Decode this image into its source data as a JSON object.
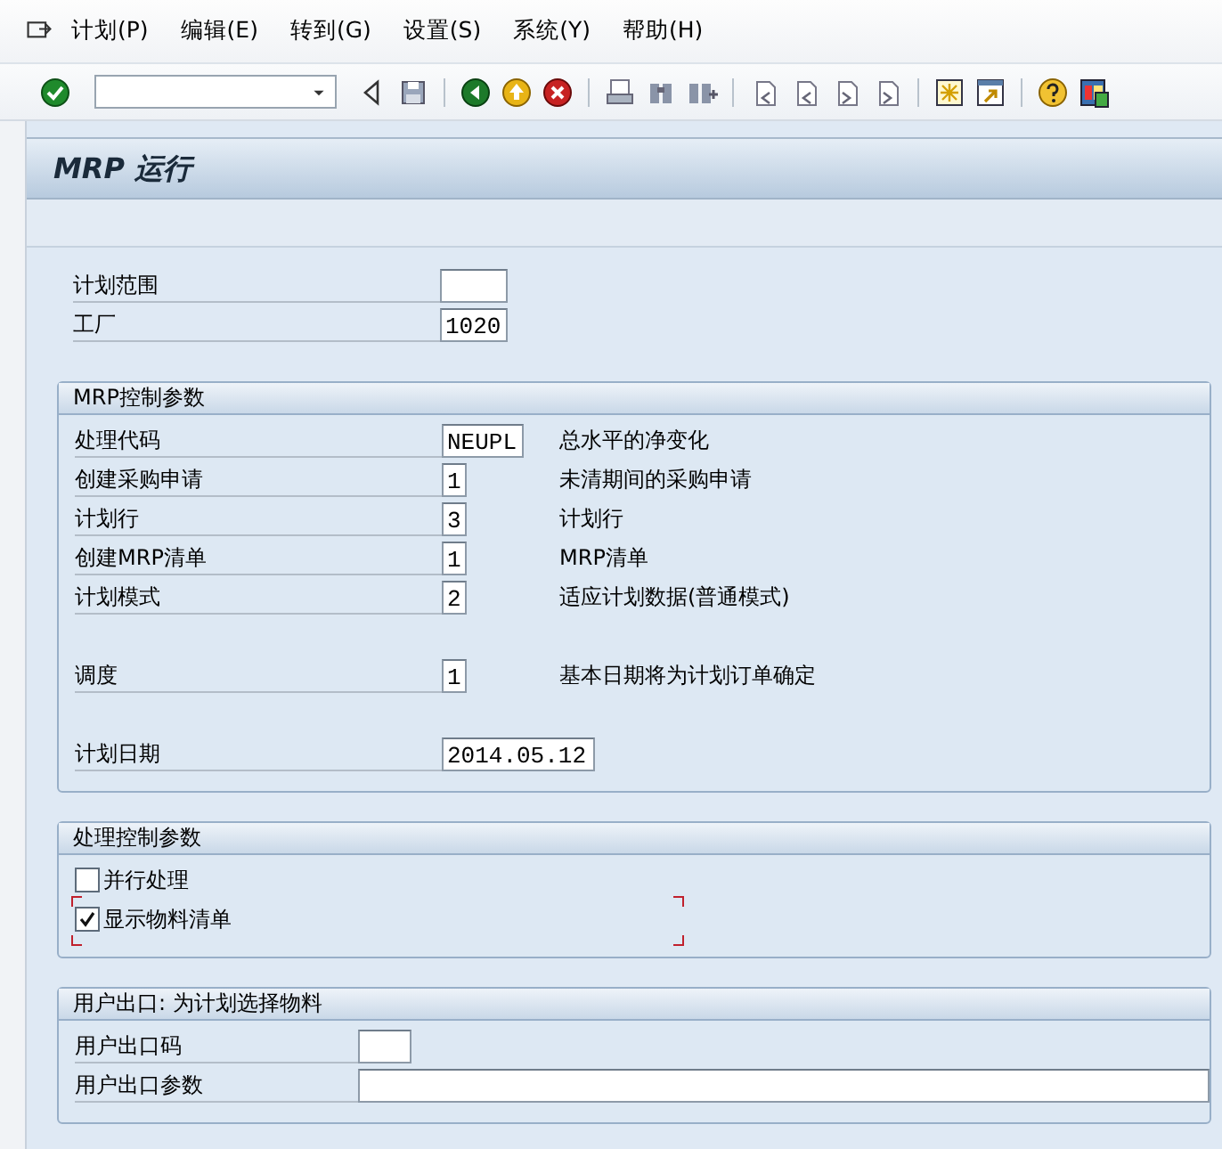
{
  "menu": [
    {
      "label": "计划(P)"
    },
    {
      "label": "编辑(E)"
    },
    {
      "label": "转到(G)"
    },
    {
      "label": "设置(S)"
    },
    {
      "label": "系统(Y)"
    },
    {
      "label": "帮助(H)"
    }
  ],
  "title": "MRP 运行",
  "top_fields": [
    {
      "label": "计划范围"
    },
    {
      "label": "工厂",
      "value": "1020"
    }
  ],
  "mrp_control": {
    "title": "MRP控制参数",
    "row_groups": [
      [
        {
          "label": "处理代码",
          "value": "NEUPL",
          "description": "总水平的净变化"
        },
        {
          "label": "创建采购申请",
          "value": "1",
          "description": "未清期间的采购申请"
        },
        {
          "label": "计划行",
          "value": "3",
          "description": "计划行"
        },
        {
          "label": "创建MRP清单",
          "value": "1",
          "description": "MRP清单"
        },
        {
          "label": "计划模式",
          "value": "2",
          "description": "适应计划数据(普通模式)"
        }
      ],
      [
        {
          "label": "调度",
          "value": "1",
          "description": "基本日期将为计划订单确定"
        }
      ],
      [
        {
          "label": "计划日期",
          "value": "2014.05.12"
        }
      ]
    ]
  },
  "processing_control": {
    "title": "处理控制参数",
    "options": [
      {
        "label": "并行处理",
        "checked": false,
        "focused": false
      },
      {
        "label": "显示物料清单",
        "checked": true,
        "focused": true
      }
    ]
  },
  "user_exit": {
    "title": "用户出口: 为计划选择物料",
    "rows": [
      {
        "label": "用户出口码",
        "kind": "short"
      },
      {
        "label": "用户出口参数",
        "kind": "long"
      }
    ]
  }
}
